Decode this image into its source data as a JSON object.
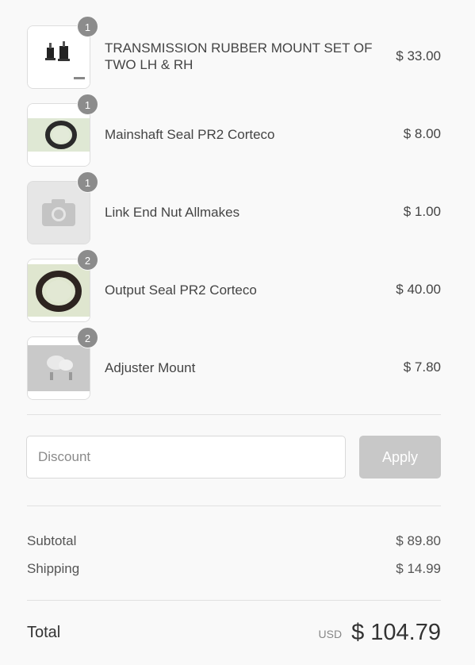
{
  "items": [
    {
      "quantity": "1",
      "name": "TRANSMISSION RUBBER MOUNT SET OF TWO LH & RH",
      "price": "$ 33.00",
      "image": "rubber-mount-photo"
    },
    {
      "quantity": "1",
      "name": "Mainshaft Seal PR2 Corteco",
      "price": "$ 8.00",
      "image": "seal-photo"
    },
    {
      "quantity": "1",
      "name": "Link End Nut Allmakes",
      "price": "$ 1.00",
      "image": "camera-placeholder-icon"
    },
    {
      "quantity": "2",
      "name": "Output Seal PR2 Corteco",
      "price": "$ 40.00",
      "image": "seal-photo"
    },
    {
      "quantity": "2",
      "name": "Adjuster Mount",
      "price": "$ 7.80",
      "image": "adjuster-mount-photo"
    }
  ],
  "discount": {
    "placeholder": "Discount",
    "value": "",
    "apply_label": "Apply"
  },
  "totals": {
    "subtotal_label": "Subtotal",
    "subtotal_value": "$ 89.80",
    "shipping_label": "Shipping",
    "shipping_value": "$ 14.99",
    "total_label": "Total",
    "currency": "USD",
    "total_value": "$ 104.79"
  },
  "colors": {
    "badge": "#8c8c8c",
    "apply_button": "#c8c8c8",
    "background": "#f9f9f9"
  }
}
